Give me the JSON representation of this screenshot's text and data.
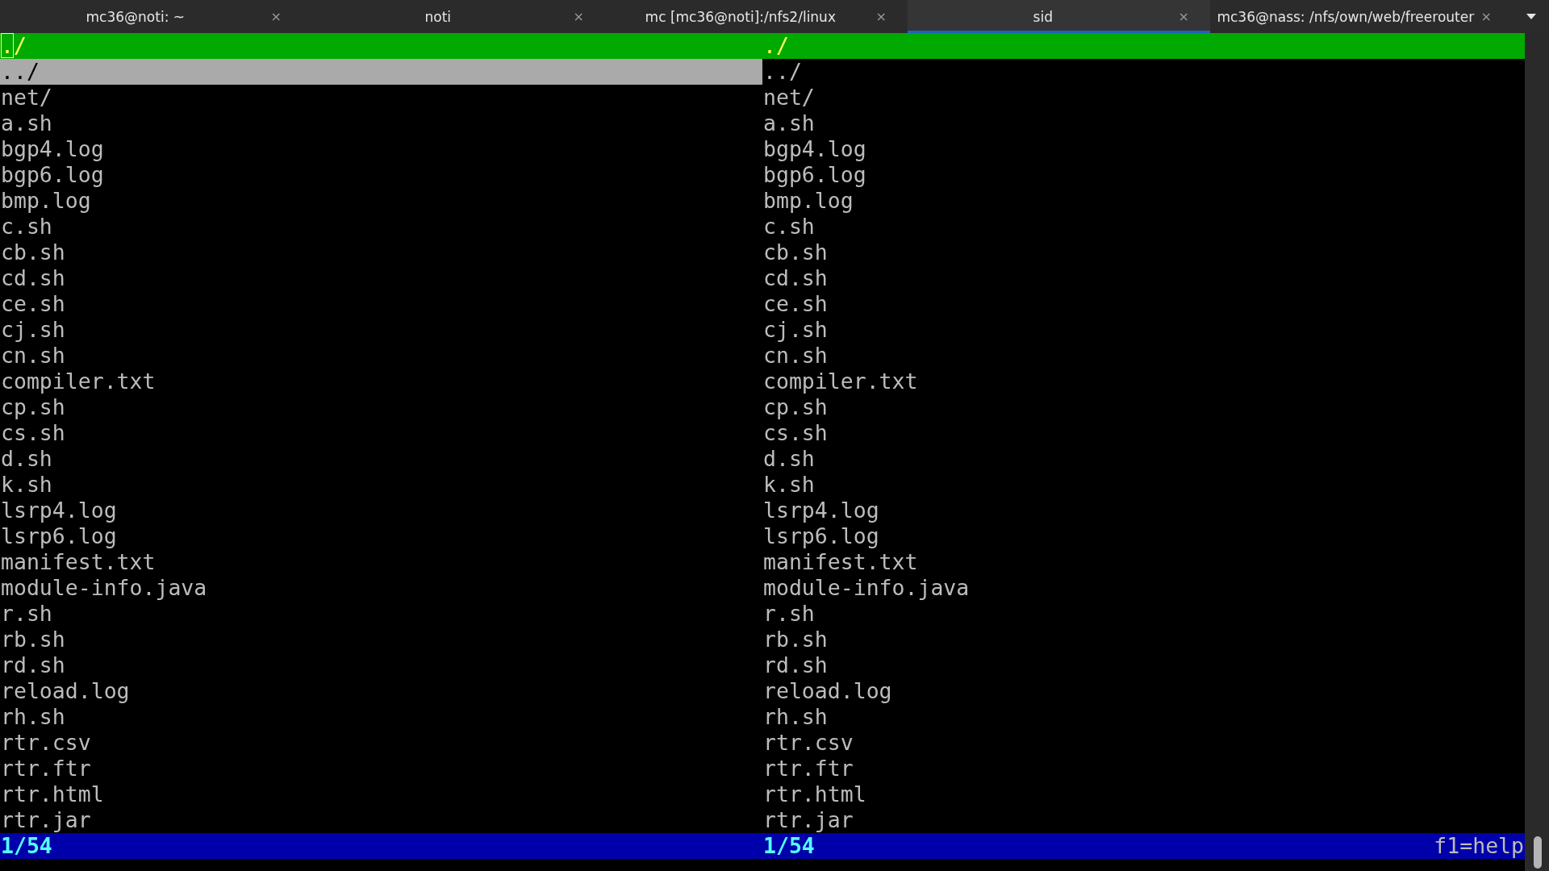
{
  "tabs": [
    {
      "title": "mc36@noti: ~",
      "selected": false
    },
    {
      "title": "noti",
      "selected": false
    },
    {
      "title": "mc [mc36@noti]:/nfs2/linux",
      "selected": false
    },
    {
      "title": "sid",
      "selected": true
    },
    {
      "title": "mc36@nass: /nfs/own/web/freerouter",
      "selected": false
    }
  ],
  "tab_close": "×",
  "panels": [
    {
      "header": "./",
      "active": true,
      "status": "1/54",
      "files": [
        {
          "name": "../",
          "selected": true
        },
        {
          "name": "net/",
          "selected": false
        },
        {
          "name": "a.sh",
          "selected": false
        },
        {
          "name": "bgp4.log",
          "selected": false
        },
        {
          "name": "bgp6.log",
          "selected": false
        },
        {
          "name": "bmp.log",
          "selected": false
        },
        {
          "name": "c.sh",
          "selected": false
        },
        {
          "name": "cb.sh",
          "selected": false
        },
        {
          "name": "cd.sh",
          "selected": false
        },
        {
          "name": "ce.sh",
          "selected": false
        },
        {
          "name": "cj.sh",
          "selected": false
        },
        {
          "name": "cn.sh",
          "selected": false
        },
        {
          "name": "compiler.txt",
          "selected": false
        },
        {
          "name": "cp.sh",
          "selected": false
        },
        {
          "name": "cs.sh",
          "selected": false
        },
        {
          "name": "d.sh",
          "selected": false
        },
        {
          "name": "k.sh",
          "selected": false
        },
        {
          "name": "lsrp4.log",
          "selected": false
        },
        {
          "name": "lsrp6.log",
          "selected": false
        },
        {
          "name": "manifest.txt",
          "selected": false
        },
        {
          "name": "module-info.java",
          "selected": false
        },
        {
          "name": "r.sh",
          "selected": false
        },
        {
          "name": "rb.sh",
          "selected": false
        },
        {
          "name": "rd.sh",
          "selected": false
        },
        {
          "name": "reload.log",
          "selected": false
        },
        {
          "name": "rh.sh",
          "selected": false
        },
        {
          "name": "rtr.csv",
          "selected": false
        },
        {
          "name": "rtr.ftr",
          "selected": false
        },
        {
          "name": "rtr.html",
          "selected": false
        },
        {
          "name": "rtr.jar",
          "selected": false
        }
      ]
    },
    {
      "header": "./",
      "active": false,
      "status": "1/54",
      "help": "f1=help",
      "files": [
        {
          "name": "../",
          "selected": false
        },
        {
          "name": "net/",
          "selected": false
        },
        {
          "name": "a.sh",
          "selected": false
        },
        {
          "name": "bgp4.log",
          "selected": false
        },
        {
          "name": "bgp6.log",
          "selected": false
        },
        {
          "name": "bmp.log",
          "selected": false
        },
        {
          "name": "c.sh",
          "selected": false
        },
        {
          "name": "cb.sh",
          "selected": false
        },
        {
          "name": "cd.sh",
          "selected": false
        },
        {
          "name": "ce.sh",
          "selected": false
        },
        {
          "name": "cj.sh",
          "selected": false
        },
        {
          "name": "cn.sh",
          "selected": false
        },
        {
          "name": "compiler.txt",
          "selected": false
        },
        {
          "name": "cp.sh",
          "selected": false
        },
        {
          "name": "cs.sh",
          "selected": false
        },
        {
          "name": "d.sh",
          "selected": false
        },
        {
          "name": "k.sh",
          "selected": false
        },
        {
          "name": "lsrp4.log",
          "selected": false
        },
        {
          "name": "lsrp6.log",
          "selected": false
        },
        {
          "name": "manifest.txt",
          "selected": false
        },
        {
          "name": "module-info.java",
          "selected": false
        },
        {
          "name": "r.sh",
          "selected": false
        },
        {
          "name": "rb.sh",
          "selected": false
        },
        {
          "name": "rd.sh",
          "selected": false
        },
        {
          "name": "reload.log",
          "selected": false
        },
        {
          "name": "rh.sh",
          "selected": false
        },
        {
          "name": "rtr.csv",
          "selected": false
        },
        {
          "name": "rtr.ftr",
          "selected": false
        },
        {
          "name": "rtr.html",
          "selected": false
        },
        {
          "name": "rtr.jar",
          "selected": false
        }
      ]
    }
  ]
}
